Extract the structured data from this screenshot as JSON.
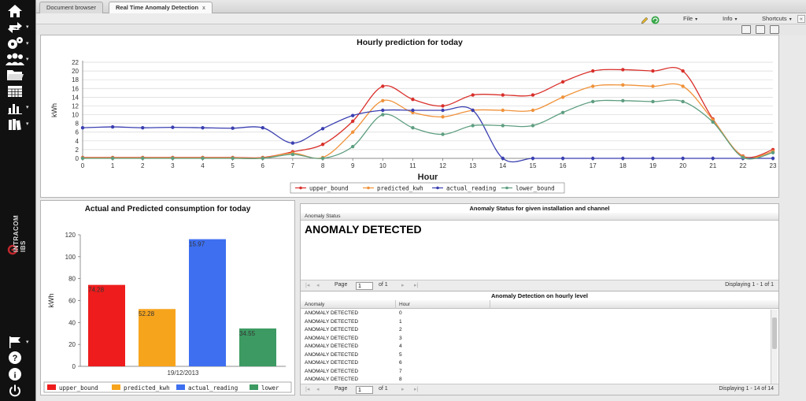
{
  "tabs": [
    {
      "label": "Document browser"
    },
    {
      "label": "Real Time Anomaly Detection",
      "close": "x"
    }
  ],
  "menu": {
    "file": "File",
    "info": "Info",
    "shortcuts": "Shortcuts"
  },
  "sidebar": {
    "icons": [
      "home-icon",
      "share-icon",
      "settings-icon",
      "users-icon",
      "folder-icon",
      "calendar-icon",
      "bar-chart-icon",
      "books-icon",
      "flag-icon",
      "help-icon",
      "info-icon",
      "power-icon"
    ],
    "logo_text": "INTRACOM IBS"
  },
  "hourly_chart": {
    "title": "Hourly prediction for today",
    "xlabel": "Hour",
    "ylabel": "kWh"
  },
  "chart_data": [
    {
      "type": "line",
      "title": "Hourly prediction for today",
      "xlabel": "Hour",
      "ylabel": "kWh",
      "x": [
        0,
        1,
        2,
        3,
        4,
        5,
        6,
        7,
        8,
        9,
        10,
        11,
        12,
        13,
        14,
        15,
        16,
        17,
        18,
        19,
        20,
        21,
        22,
        23
      ],
      "ylim": [
        0,
        22
      ],
      "yticks": [
        0,
        2,
        4,
        6,
        8,
        10,
        12,
        14,
        16,
        18,
        20,
        22
      ],
      "grid": true,
      "legend_position": "bottom",
      "series": [
        {
          "name": "upper_bound",
          "color": "#d9302b",
          "values": [
            0.2,
            0.2,
            0.2,
            0.2,
            0.2,
            0.2,
            0.2,
            1.5,
            3.2,
            8.5,
            16.5,
            13.5,
            12,
            14.5,
            14.5,
            14.5,
            17.5,
            20,
            20.3,
            20,
            20,
            9,
            0.5,
            2
          ]
        },
        {
          "name": "predicted_kwh",
          "color": "#f0923a",
          "values": [
            0.1,
            0.1,
            0.1,
            0.1,
            0.1,
            0.1,
            0.1,
            1.2,
            0.2,
            6,
            13.2,
            10.5,
            9.5,
            11,
            11,
            11,
            14,
            16.5,
            16.8,
            16.5,
            16.5,
            8.8,
            0.4,
            1.6
          ]
        },
        {
          "name": "actual_reading",
          "color": "#3a3fb0",
          "values": [
            7,
            7.2,
            7,
            7.1,
            7,
            6.9,
            7,
            3.5,
            6.8,
            9.8,
            11,
            11,
            11,
            11,
            0,
            0,
            0,
            0,
            0,
            0,
            0,
            0,
            0,
            0
          ]
        },
        {
          "name": "lower_bound",
          "color": "#5e9e80",
          "values": [
            0,
            0,
            0,
            0,
            0,
            0,
            0,
            0.9,
            0,
            2.7,
            10,
            7,
            5.5,
            7.5,
            7.5,
            7.5,
            10.5,
            13,
            13.2,
            13,
            13,
            8.3,
            0.2,
            1.3
          ]
        }
      ]
    },
    {
      "type": "bar",
      "title": "Actual and Predicted consumption for today",
      "ylabel": "kWh",
      "categories": [
        "19/12/2013"
      ],
      "ylim": [
        0,
        120
      ],
      "yticks": [
        0,
        20,
        40,
        60,
        80,
        100,
        120
      ],
      "legend_position": "bottom",
      "series": [
        {
          "name": "upper_bound",
          "color": "#ee1c1c",
          "values": [
            74.28
          ],
          "label": "74.28"
        },
        {
          "name": "predicted_kwh",
          "color": "#f7a41d",
          "values": [
            52.28
          ],
          "label": "52.28"
        },
        {
          "name": "actual_reading",
          "color": "#3d6ff0",
          "values": [
            115.97
          ],
          "label": "15.97"
        },
        {
          "name": "lower_bound",
          "color": "#3c9a62",
          "values": [
            34.55
          ],
          "label": "34.55"
        }
      ]
    }
  ],
  "bar_chart": {
    "title": "Actual and Predicted consumption for today",
    "legend_visible": [
      "upper_bound",
      "predicted_kwh",
      "actual_reading",
      "lower"
    ]
  },
  "status_panel": {
    "title": "Anomaly Status for given installation and channel",
    "column": "Anomaly Status",
    "value": "ANOMALY DETECTED",
    "pager": {
      "page_label": "Page",
      "page": "1",
      "of": "of 1",
      "displaying": "Displaying 1 - 1 of 1"
    }
  },
  "hourly_panel": {
    "title": "Anomaly Detection on hourly level",
    "columns": [
      "Anomaly",
      "Hour"
    ],
    "rows": [
      {
        "anomaly": "ANOMALY DETECTED",
        "hour": "0"
      },
      {
        "anomaly": "ANOMALY DETECTED",
        "hour": "1"
      },
      {
        "anomaly": "ANOMALY DETECTED",
        "hour": "2"
      },
      {
        "anomaly": "ANOMALY DETECTED",
        "hour": "3"
      },
      {
        "anomaly": "ANOMALY DETECTED",
        "hour": "4"
      },
      {
        "anomaly": "ANOMALY DETECTED",
        "hour": "5"
      },
      {
        "anomaly": "ANOMALY DETECTED",
        "hour": "6"
      },
      {
        "anomaly": "ANOMALY DETECTED",
        "hour": "7"
      },
      {
        "anomaly": "ANOMALY DETECTED",
        "hour": "8"
      }
    ],
    "pager": {
      "page_label": "Page",
      "page": "1",
      "of": "of 1",
      "displaying": "Displaying 1 - 14 of 14"
    }
  }
}
